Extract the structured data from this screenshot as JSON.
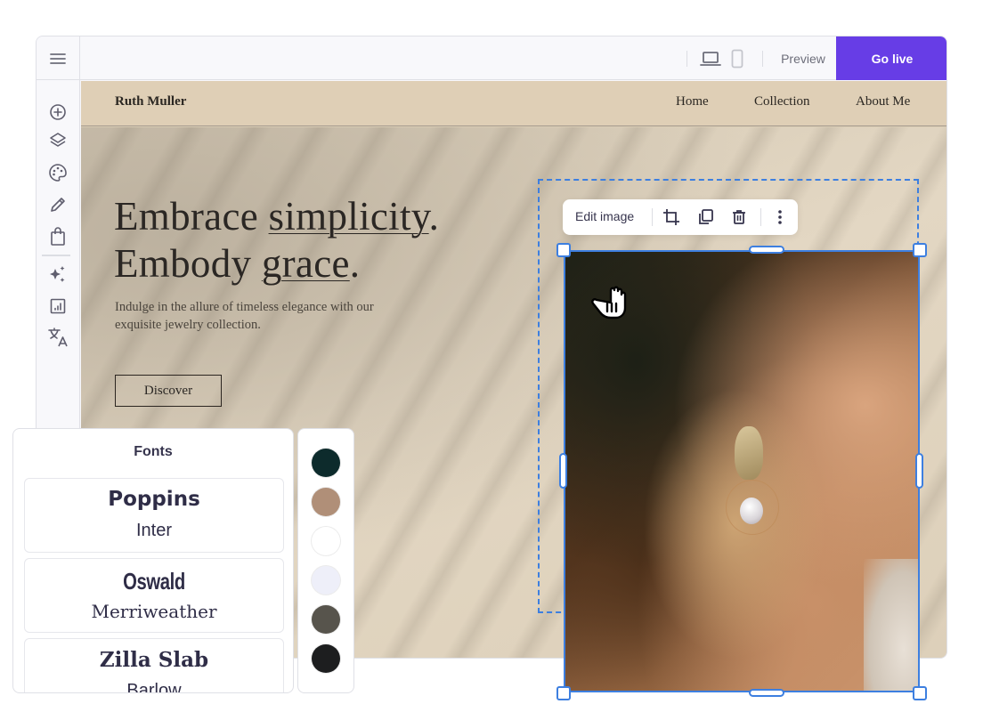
{
  "topbar": {
    "menu_icon": "hamburger-menu-icon",
    "devices": [
      {
        "name": "desktop",
        "icon": "laptop-icon",
        "active": true
      },
      {
        "name": "mobile",
        "icon": "mobile-icon",
        "active": false
      }
    ],
    "preview_label": "Preview",
    "go_live_label": "Go live",
    "accent_color": "#673de6"
  },
  "sidebar": {
    "items": [
      {
        "name": "add-element",
        "icon": "plus-circle-icon"
      },
      {
        "name": "layers",
        "icon": "layers-icon"
      },
      {
        "name": "styles",
        "icon": "palette-icon"
      },
      {
        "name": "edit",
        "icon": "pencil-icon"
      },
      {
        "name": "store",
        "icon": "shopping-bag-icon"
      },
      {
        "name": "ai-tools",
        "icon": "sparkles-icon"
      },
      {
        "name": "analytics",
        "icon": "chart-icon"
      },
      {
        "name": "translate",
        "icon": "translate-icon"
      }
    ]
  },
  "site": {
    "brand": "Ruth Muller",
    "nav": [
      "Home",
      "Collection",
      "About Me"
    ],
    "hero": {
      "title_line1_a": "Embrace ",
      "title_line1_b": "simplicity",
      "title_line1_c": ".",
      "title_line2_a": "Embody ",
      "title_line2_b": "grace",
      "title_line2_c": ".",
      "subtitle": "Indulge in the allure of timeless elegance with our exquisite jewelry collection.",
      "cta": "Discover"
    }
  },
  "image_toolbar": {
    "edit_label": "Edit image",
    "actions": [
      {
        "name": "crop",
        "icon": "crop-icon"
      },
      {
        "name": "duplicate",
        "icon": "duplicate-icon"
      },
      {
        "name": "delete",
        "icon": "trash-icon"
      },
      {
        "name": "more",
        "icon": "more-vertical-icon"
      }
    ],
    "selection_color": "#3d7fe0"
  },
  "fonts_panel": {
    "title": "Fonts",
    "pairs": [
      {
        "primary": "Poppins",
        "secondary": "Inter"
      },
      {
        "primary": "Oswald",
        "secondary": "Merriweather"
      },
      {
        "primary": "Zilla Slab",
        "secondary": "Barlow"
      }
    ]
  },
  "colors_panel": {
    "swatches": [
      "#0d2b2c",
      "#b08f78",
      "#ffffff",
      "#eeeff9",
      "#57544c",
      "#1d1e1f"
    ]
  }
}
